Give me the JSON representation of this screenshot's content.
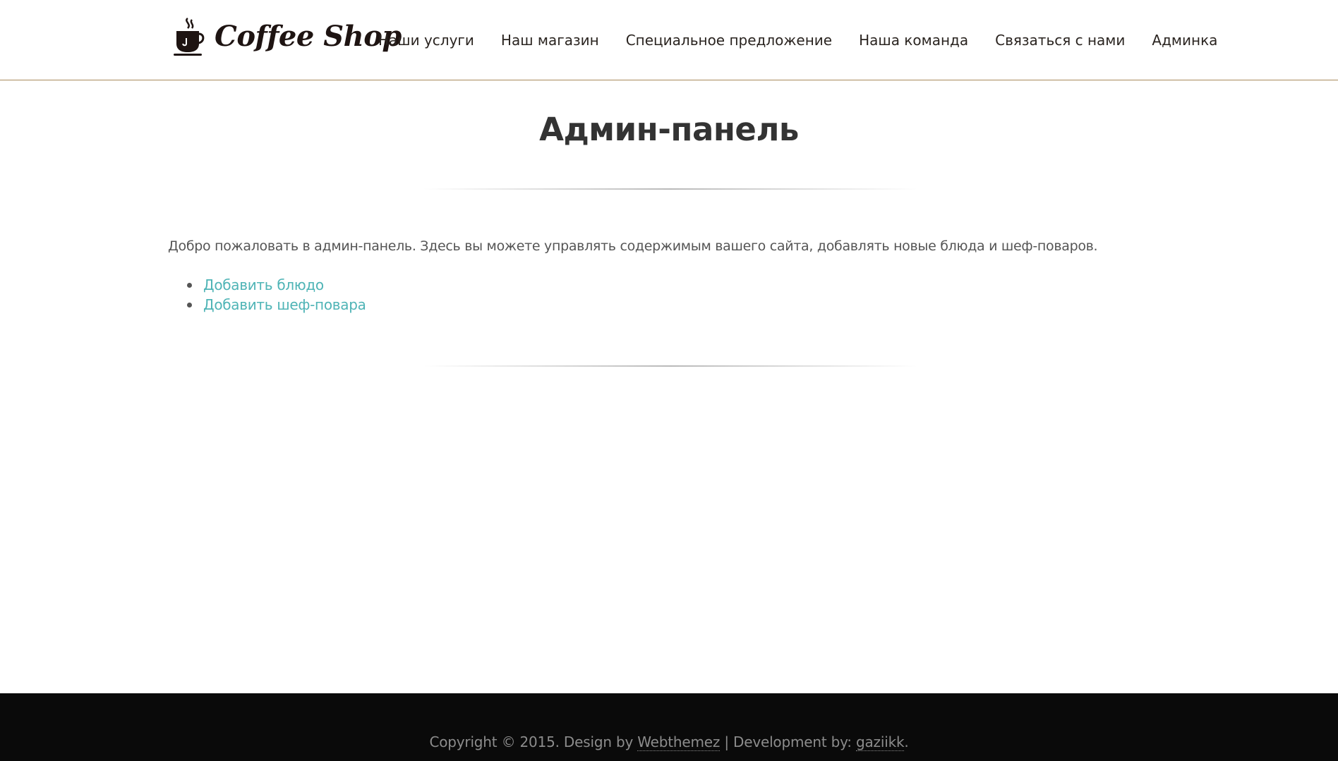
{
  "header": {
    "logo_text": "Coffee Shop",
    "logo_icon": "coffee-cup-icon",
    "nav": [
      {
        "label": "Наши услуги"
      },
      {
        "label": "Наш магазин"
      },
      {
        "label": "Специальное предложение"
      },
      {
        "label": "Наша команда"
      },
      {
        "label": "Связаться с нами"
      },
      {
        "label": "Админка"
      }
    ]
  },
  "main": {
    "title": "Админ-панель",
    "intro": "Добро пожаловать в админ-панель. Здесь вы можете управлять содержимым вашего сайта, добавлять новые блюда и шеф-поваров.",
    "links": [
      {
        "label": "Добавить блюдо"
      },
      {
        "label": "Добавить шеф-повара"
      }
    ]
  },
  "footer": {
    "prefix": "Copyright © 2015. Design by ",
    "design_link": "Webthemez",
    "separator": " | Development by: ",
    "dev_link": "gaziikk",
    "suffix": "."
  },
  "colors": {
    "link": "#4fb4b6",
    "header_border": "#a88a5a",
    "footer_bg": "#0a0a0a",
    "text": "#555555",
    "title": "#333333"
  }
}
